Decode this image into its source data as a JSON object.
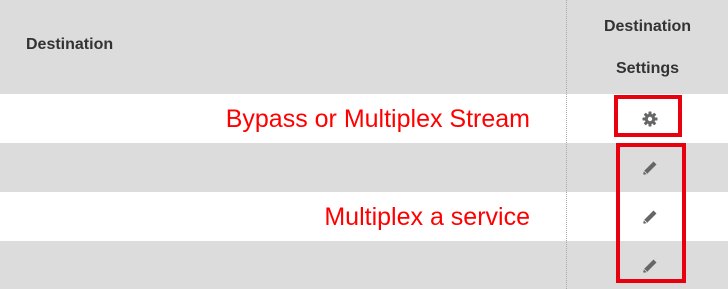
{
  "header": {
    "destination_label": "Destination",
    "settings_line1": "Destination",
    "settings_line2": "Settings"
  },
  "rows": [
    {
      "annotation": "Bypass or Multiplex Stream",
      "icon": "gear-icon",
      "shaded": false
    },
    {
      "annotation": "",
      "icon": "pencil-icon",
      "shaded": true
    },
    {
      "annotation": "Multiplex a service",
      "icon": "pencil-icon",
      "shaded": false
    },
    {
      "annotation": "",
      "icon": "pencil-icon",
      "shaded": true
    }
  ],
  "colors": {
    "annotation_text": "#ff0000",
    "highlight_box": "#e8000e",
    "row_shade": "#dcdcdc",
    "icon": "#666666"
  }
}
